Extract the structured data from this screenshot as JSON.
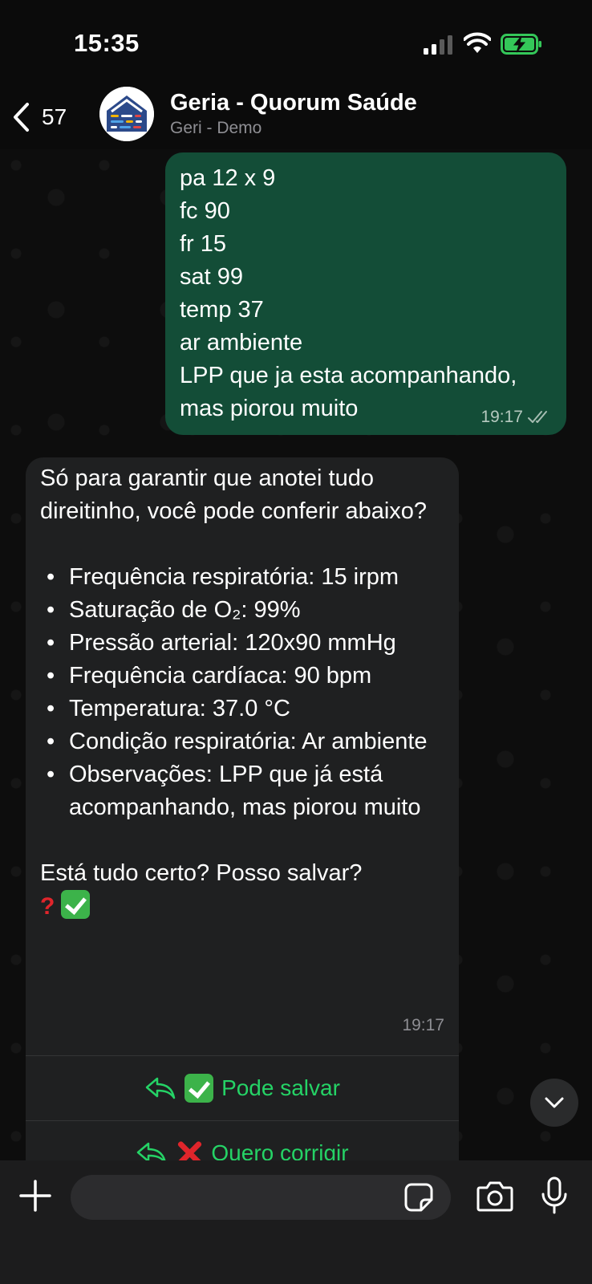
{
  "status_bar": {
    "time": "15:35"
  },
  "header": {
    "back_count": "57",
    "title": "Geria - Quorum Saúde",
    "subtitle": "Geri - Demo"
  },
  "outgoing_message": {
    "lines": [
      "pa 12 x 9",
      "fc 90",
      "fr 15",
      "sat 99",
      "temp 37",
      "ar ambiente",
      "LPP que ja esta acompanhando,",
      "mas piorou muito"
    ],
    "time": "19:17",
    "status_icon": "double-check-read-icon"
  },
  "incoming_message": {
    "intro": "Só para garantir que anotei tudo direitinho, você pode conferir abaixo?",
    "items": [
      "Frequência respiratória: 15 irpm",
      "Saturação de O₂: 99%",
      "Pressão arterial: 120x90 mmHg",
      "Frequência cardíaca: 90 bpm",
      "Temperatura: 37.0 °C",
      "Condição respiratória: Ar ambiente",
      "Observações: LPP que já está acompanhando, mas piorou muito"
    ],
    "question": "Está tudo certo? Posso salvar?",
    "time": "19:17",
    "quick_replies": [
      {
        "label": "Pode salvar",
        "emoji": "check-mark-emoji"
      },
      {
        "label": "Quero corrigir",
        "emoji": "cross-mark-emoji"
      }
    ]
  },
  "input_bar": {
    "placeholder": "",
    "value": ""
  },
  "colors": {
    "outgoing_bubble": "#134d37",
    "incoming_bubble": "#1f2021",
    "accent_green": "#25d366"
  }
}
